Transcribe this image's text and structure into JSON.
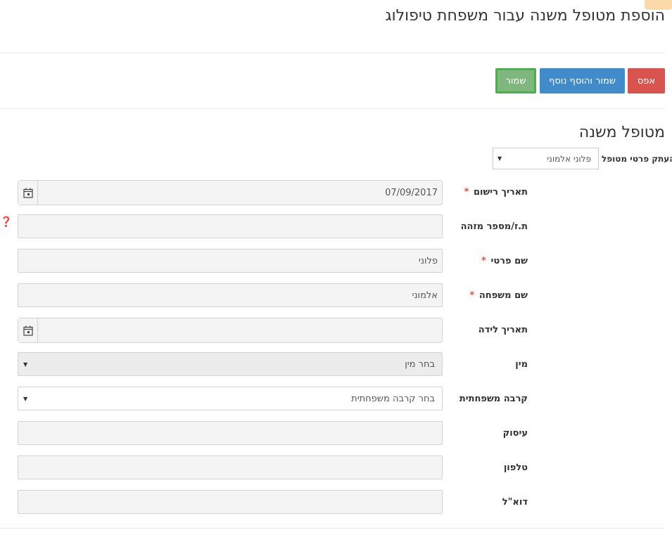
{
  "page": {
    "title": "הוספת מטופל משנה עבור משפחת טיפולוג"
  },
  "toolbar": {
    "reset_label": "אפס",
    "save_add_label": "שמור והוסף נוסף",
    "save_label": "שמור"
  },
  "section": {
    "title": "מטופל משנה",
    "copy_label": "העתק פרטי מטופל",
    "copy_value": "פלוני אלמוני"
  },
  "form": {
    "registration_date": {
      "label": "תאריך רישום",
      "required_mark": "*",
      "value": "07/09/2017"
    },
    "id_number": {
      "label": "ת.ז/מספר מזהה",
      "value": "",
      "help_icon": "question-circle-icon"
    },
    "first_name": {
      "label": "שם פרטי",
      "required_mark": "*",
      "value": "פלוני"
    },
    "last_name": {
      "label": "שם משפחה",
      "required_mark": "*",
      "value": "אלמוני"
    },
    "birth_date": {
      "label": "תאריך לידה",
      "value": ""
    },
    "gender": {
      "label": "מין",
      "value": "בחר מין"
    },
    "relation": {
      "label": "קרבה משפחתית",
      "value": "בחר קרבה משפחתית"
    },
    "occupation": {
      "label": "עיסוק",
      "value": ""
    },
    "phone": {
      "label": "טלפון",
      "value": ""
    },
    "email": {
      "label": "דוא\"ל",
      "value": ""
    }
  },
  "icons": {
    "calendar": "calendar-icon",
    "dropdown": "caret-down-icon"
  },
  "colors": {
    "reset": "#d9534f",
    "save_add": "#428bca",
    "save": "#7fb77e",
    "save_border": "#4cae4c",
    "required": "#d9534f"
  }
}
